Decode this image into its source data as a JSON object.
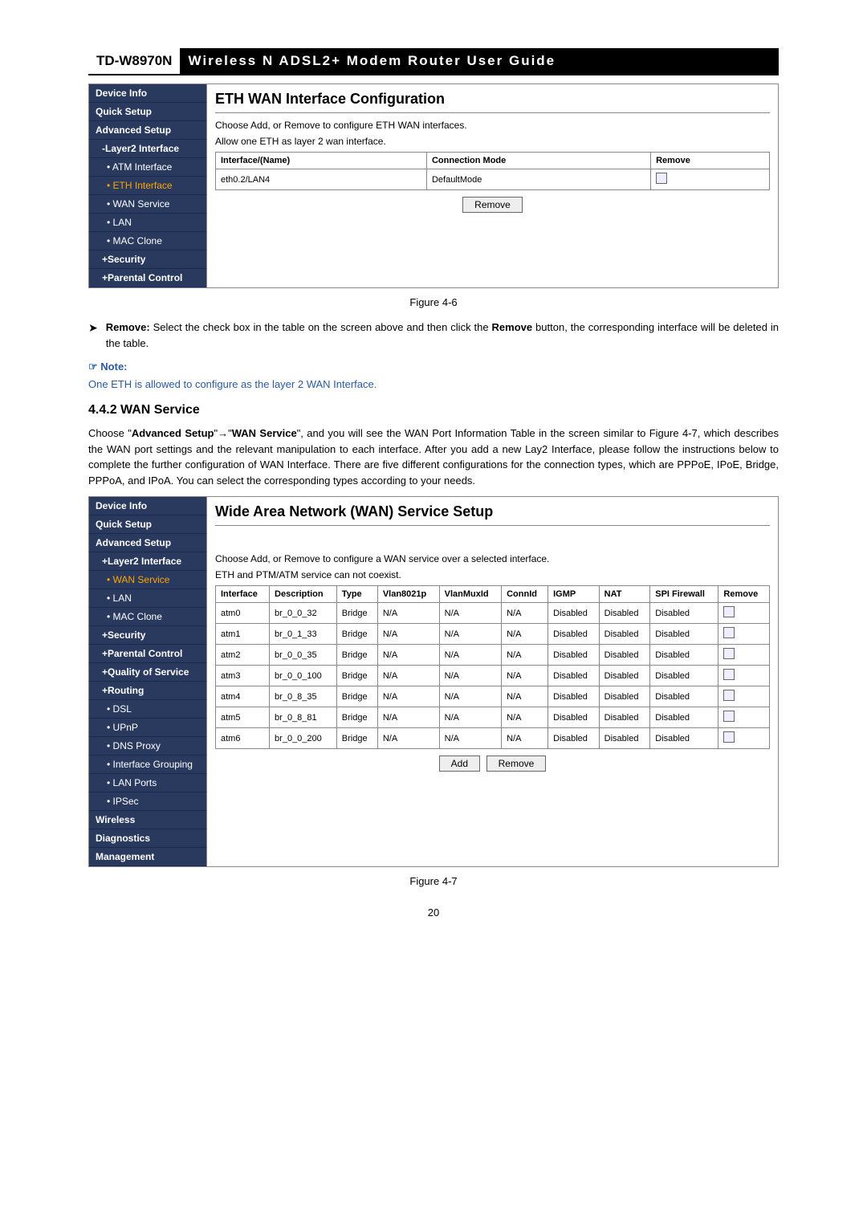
{
  "header": {
    "model": "TD-W8970N",
    "title": "Wireless N ADSL2+ Modem Router User Guide"
  },
  "screenshot1": {
    "sidebar": [
      "Device Info",
      "Quick Setup",
      "Advanced Setup",
      "-Layer2 Interface",
      "• ATM Interface",
      "• ETH Interface",
      "• WAN Service",
      "• LAN",
      "• MAC Clone",
      "+Security",
      "+Parental Control"
    ],
    "activeIndex": 5,
    "title": "ETH WAN Interface Configuration",
    "hint1": "Choose Add, or Remove to configure ETH WAN interfaces.",
    "hint2": "Allow one ETH as layer 2 wan interface.",
    "th": [
      "Interface/(Name)",
      "Connection Mode",
      "Remove"
    ],
    "row": [
      "eth0.2/LAN4",
      "DefaultMode"
    ],
    "btn": "Remove"
  },
  "fig1": "Figure 4-6",
  "removeText": {
    "label": "Remove:",
    "body": " Select the check box in the table on the screen above and then click the ",
    "bold": "Remove",
    "tail": " button, the corresponding interface will be deleted in the table."
  },
  "noteLabel": "Note:",
  "noteBody": "One ETH is allowed to configure as the layer 2 WAN Interface.",
  "section": "4.4.2   WAN Service",
  "wanPara": {
    "p1": "Choose \"",
    "b1": "Advanced Setup",
    "p2": "\"→\"",
    "b2": "WAN Service",
    "p3": "\", and you will see the WAN Port Information Table in the screen similar to Figure 4-7, which describes the WAN port settings and the relevant manipulation to each interface. After you add a new Lay2 Interface, please follow the instructions below to complete the further configuration of WAN Interface. There are five different configurations for the connection types, which are PPPoE, IPoE, Bridge, PPPoA, and IPoA. You can select the corresponding types according to your needs."
  },
  "screenshot2": {
    "sidebar": [
      "Device Info",
      "Quick Setup",
      "Advanced Setup",
      "+Layer2 Interface",
      "• WAN Service",
      "• LAN",
      "• MAC Clone",
      "+Security",
      "+Parental Control",
      "+Quality of Service",
      "+Routing",
      "• DSL",
      "• UPnP",
      "• DNS Proxy",
      "• Interface Grouping",
      "• LAN Ports",
      "• IPSec",
      "Wireless",
      "Diagnostics",
      "Management"
    ],
    "activeIndex": 4,
    "title": "Wide Area Network (WAN) Service Setup",
    "hint1": "Choose Add, or Remove to configure a WAN service over a selected interface.",
    "hint2": "ETH and PTM/ATM service can not coexist.",
    "th": [
      "Interface",
      "Description",
      "Type",
      "Vlan8021p",
      "VlanMuxId",
      "ConnId",
      "IGMP",
      "NAT",
      "SPI Firewall",
      "Remove"
    ],
    "rows": [
      [
        "atm0",
        "br_0_0_32",
        "Bridge",
        "N/A",
        "N/A",
        "N/A",
        "Disabled",
        "Disabled",
        "Disabled"
      ],
      [
        "atm1",
        "br_0_1_33",
        "Bridge",
        "N/A",
        "N/A",
        "N/A",
        "Disabled",
        "Disabled",
        "Disabled"
      ],
      [
        "atm2",
        "br_0_0_35",
        "Bridge",
        "N/A",
        "N/A",
        "N/A",
        "Disabled",
        "Disabled",
        "Disabled"
      ],
      [
        "atm3",
        "br_0_0_100",
        "Bridge",
        "N/A",
        "N/A",
        "N/A",
        "Disabled",
        "Disabled",
        "Disabled"
      ],
      [
        "atm4",
        "br_0_8_35",
        "Bridge",
        "N/A",
        "N/A",
        "N/A",
        "Disabled",
        "Disabled",
        "Disabled"
      ],
      [
        "atm5",
        "br_0_8_81",
        "Bridge",
        "N/A",
        "N/A",
        "N/A",
        "Disabled",
        "Disabled",
        "Disabled"
      ],
      [
        "atm6",
        "br_0_0_200",
        "Bridge",
        "N/A",
        "N/A",
        "N/A",
        "Disabled",
        "Disabled",
        "Disabled"
      ]
    ],
    "btnAdd": "Add",
    "btnRemove": "Remove"
  },
  "fig2": "Figure 4-7",
  "pageNum": "20"
}
